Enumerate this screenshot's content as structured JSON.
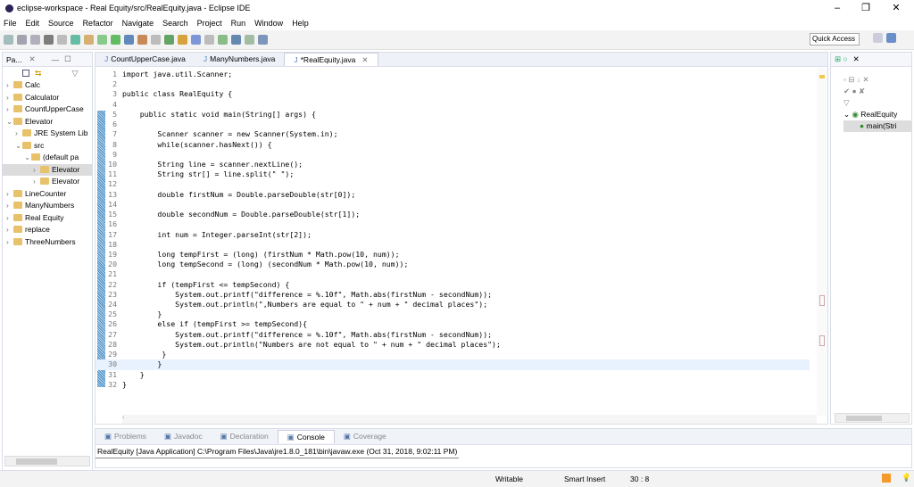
{
  "window": {
    "title": "eclipse-workspace - Real Equity/src/RealEquity.java - Eclipse IDE",
    "minimize": "–",
    "maximize": "❐",
    "close": "✕"
  },
  "menu": [
    "File",
    "Edit",
    "Source",
    "Refactor",
    "Navigate",
    "Search",
    "Project",
    "Run",
    "Window",
    "Help"
  ],
  "toolbar": {
    "quick_access": "Quick Access"
  },
  "package_explorer": {
    "title": "Pa...",
    "items": [
      {
        "label": "Calc",
        "indent": 0,
        "arrow": ">"
      },
      {
        "label": "Calculator",
        "indent": 0,
        "arrow": ">"
      },
      {
        "label": "CountUpperCase",
        "indent": 0,
        "arrow": ">"
      },
      {
        "label": "Elevator",
        "indent": 0,
        "arrow": "v"
      },
      {
        "label": "JRE System Lib",
        "indent": 1,
        "arrow": ">"
      },
      {
        "label": "src",
        "indent": 1,
        "arrow": "v"
      },
      {
        "label": "(default pa",
        "indent": 2,
        "arrow": "v"
      },
      {
        "label": "Elevator",
        "indent": 3,
        "arrow": ">",
        "selected": true
      },
      {
        "label": "Elevator",
        "indent": 3,
        "arrow": ">"
      },
      {
        "label": "LineCounter",
        "indent": 0,
        "arrow": ">"
      },
      {
        "label": "ManyNumbers",
        "indent": 0,
        "arrow": ">"
      },
      {
        "label": "Real Equity",
        "indent": 0,
        "arrow": ">"
      },
      {
        "label": "replace",
        "indent": 0,
        "arrow": ">"
      },
      {
        "label": "ThreeNumbers",
        "indent": 0,
        "arrow": ">"
      }
    ]
  },
  "editor": {
    "tabs": [
      "CountUpperCase.java",
      "ManyNumbers.java",
      "*RealEquity.java"
    ],
    "active_tab": 2,
    "current_line": 30,
    "lines": [
      "import java.util.Scanner;",
      "",
      "public class RealEquity {",
      "",
      "    public static void main(String[] args) {",
      "",
      "        Scanner scanner = new Scanner(System.in);",
      "        while(scanner.hasNext()) {",
      "",
      "        String line = scanner.nextLine();",
      "        String str[] = line.split(\" \");",
      "",
      "        double firstNum = Double.parseDouble(str[0]);",
      "",
      "        double secondNum = Double.parseDouble(str[1]);",
      "",
      "        int num = Integer.parseInt(str[2]);",
      "",
      "        long tempFirst = (long) (firstNum * Math.pow(10, num));",
      "        long tempSecond = (long) (secondNum * Math.pow(10, num));",
      "",
      "        if (tempFirst <= tempSecond) {",
      "            System.out.printf(\"difference = %.10f\", Math.abs(firstNum - secondNum));",
      "            System.out.println(\",Numbers are equal to \" + num + \" decimal places\");",
      "        }",
      "        else if (tempFirst >= tempSecond){",
      "            System.out.printf(\"difference = %.10f\", Math.abs(firstNum - secondNum));",
      "            System.out.println(\"Numbers are not equal to \" + num + \" decimal places\");",
      "         }",
      "        }",
      "    }",
      "}"
    ]
  },
  "outline": {
    "class": "RealEquity",
    "method": "main(Stri"
  },
  "bottom": {
    "tabs": [
      "Problems",
      "Javadoc",
      "Declaration",
      "Console",
      "Coverage"
    ],
    "active_tab": 3,
    "console_header": "RealEquity [Java Application] C:\\Program Files\\Java\\jre1.8.0_181\\bin\\javaw.exe (Oct 31, 2018, 9:02:11 PM)"
  },
  "status": {
    "writable": "Writable",
    "insert_mode": "Smart Insert",
    "position": "30 : 8"
  }
}
